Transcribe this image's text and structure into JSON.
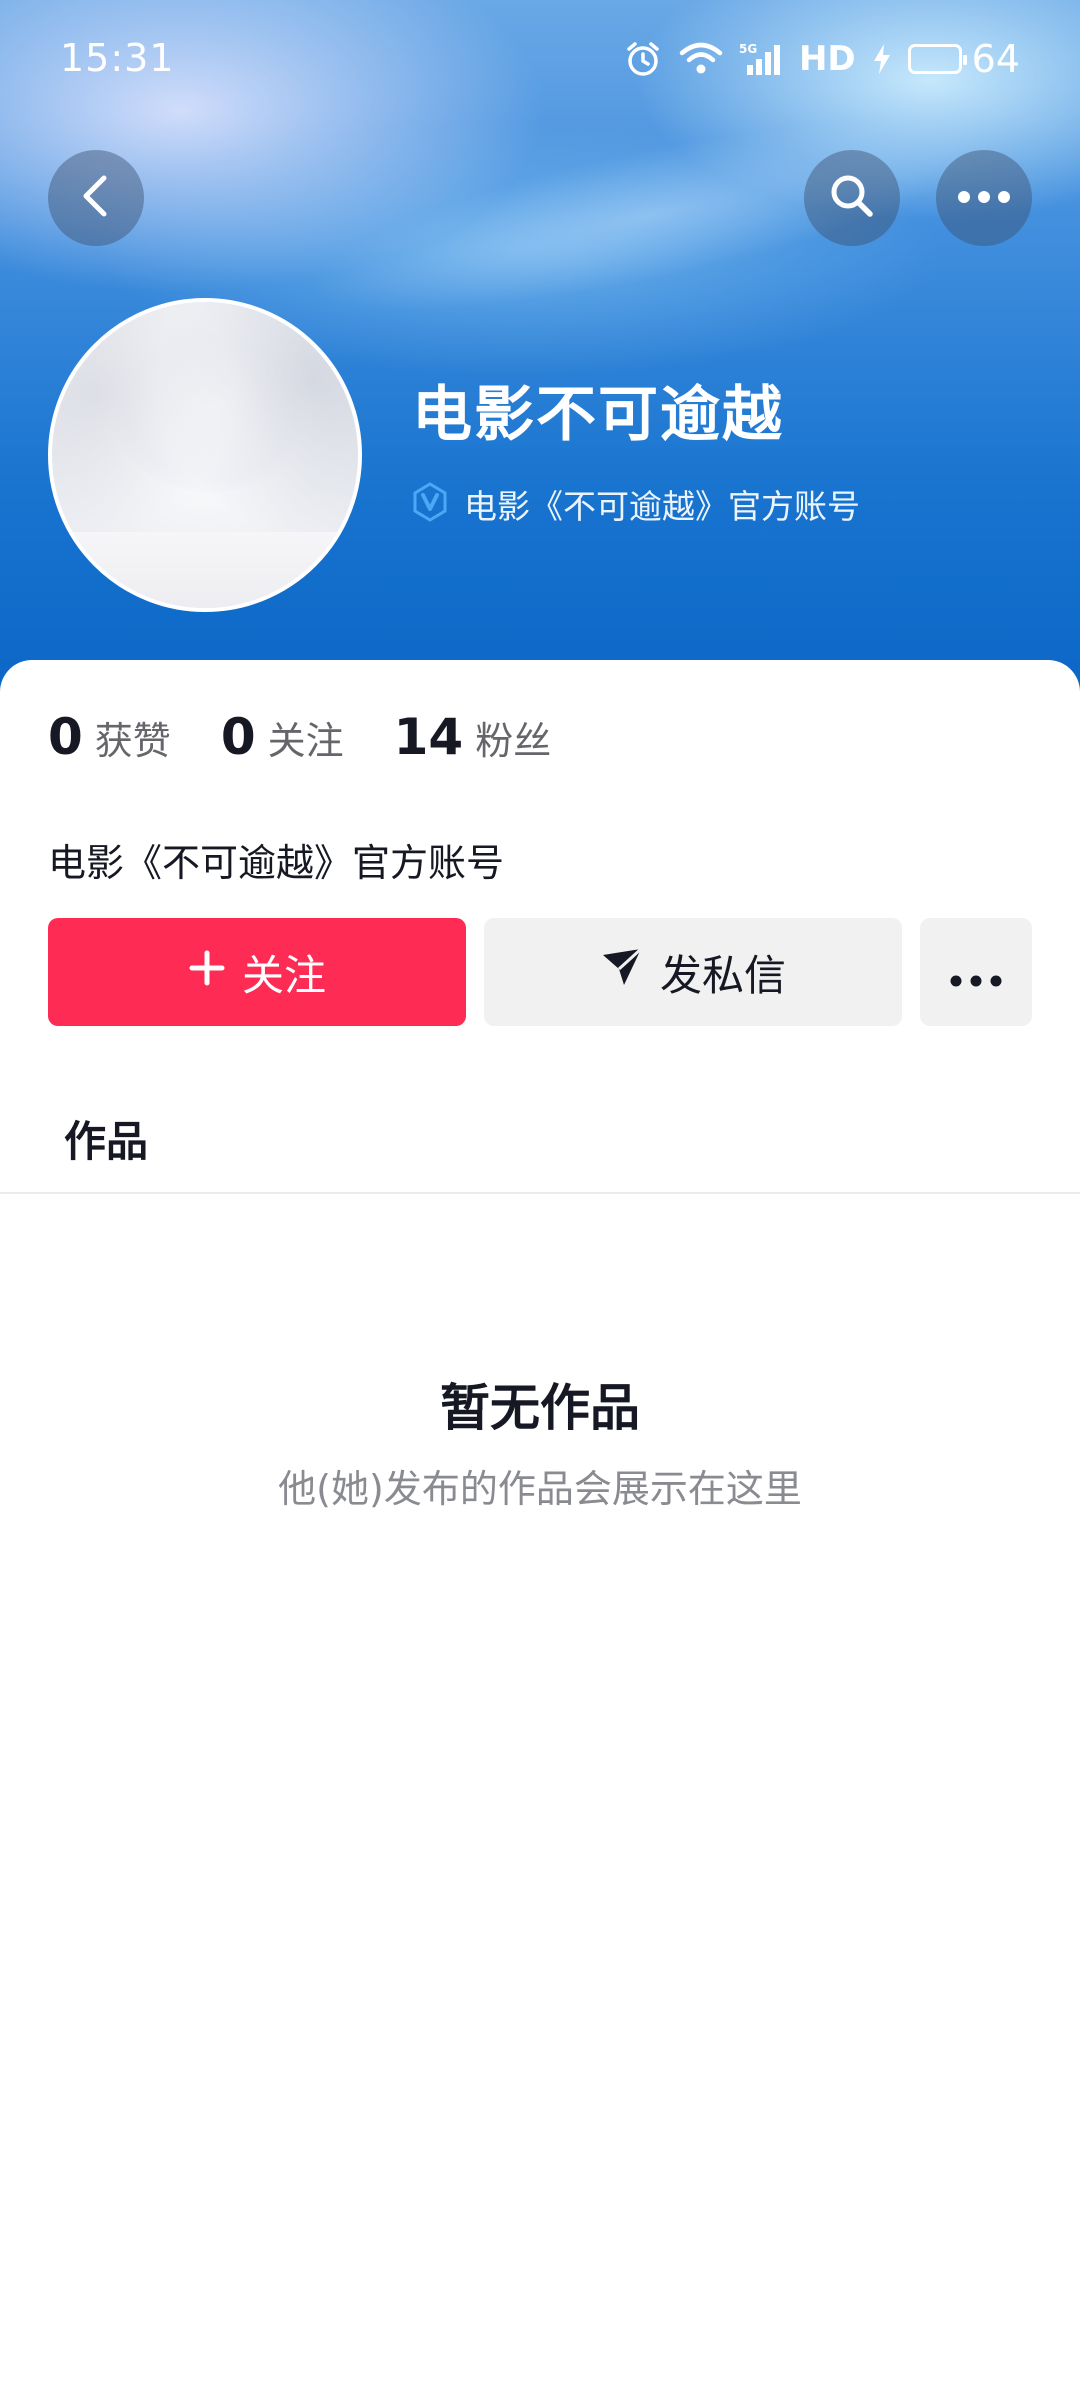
{
  "status_bar": {
    "time": "15:31",
    "network_badge": "5G",
    "hd_label": "HD",
    "battery_percent": "64",
    "battery_level": 0.64,
    "icons": [
      "alarm-icon",
      "wifi-icon",
      "signal-icon",
      "charging-icon",
      "battery-icon"
    ]
  },
  "nav": {
    "icons": [
      "back-icon",
      "search-icon",
      "more-icon"
    ]
  },
  "profile": {
    "name": "电影不可逾越",
    "verified_label": "电影《不可逾越》官方账号",
    "bio": "电影《不可逾越》官方账号"
  },
  "stats": [
    {
      "value": "0",
      "label": "获赞"
    },
    {
      "value": "0",
      "label": "关注"
    },
    {
      "value": "14",
      "label": "粉丝"
    }
  ],
  "actions": {
    "follow_label": "关注",
    "message_label": "发私信"
  },
  "tabs": {
    "works_label": "作品"
  },
  "empty_state": {
    "title": "暂无作品",
    "subtitle": "他(她)发布的作品会展示在这里"
  },
  "colors": {
    "accent": "#fe2c55",
    "secondary_button": "#f1f1f2",
    "verified": "#4aa8f5"
  }
}
